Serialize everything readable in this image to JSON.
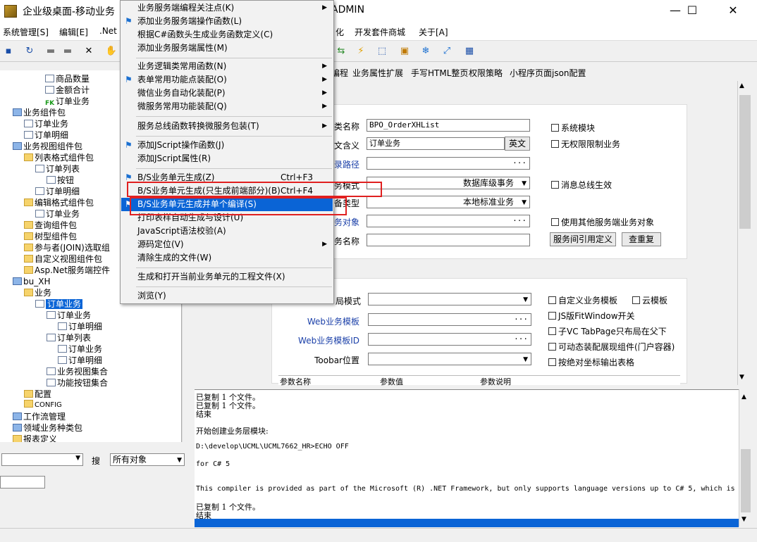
{
  "window": {
    "title": "企业级桌面-移动业务",
    "title_tail": "ADMIN",
    "controls": {
      "minimize": "—",
      "maximize": "☐",
      "close": "✕"
    }
  },
  "menubar": {
    "items": [
      "系统管理[S]",
      "编辑[E]",
      ".Net",
      "化",
      "开发套件商城",
      "关于[A]"
    ]
  },
  "tree": {
    "nodes": [
      {
        "label": "商品数量",
        "icon": "doc"
      },
      {
        "label": "金额合计",
        "icon": "doc"
      },
      {
        "label": "订单业务",
        "icon": "fk",
        "icon_text": "FK"
      },
      {
        "label": "业务组件包",
        "icon": "pkg"
      },
      {
        "label": "订单业务",
        "icon": "doc"
      },
      {
        "label": "订单明细",
        "icon": "doc"
      },
      {
        "label": "业务视图组件包",
        "icon": "pkg"
      },
      {
        "label": "列表格式组件包",
        "icon": "folder"
      },
      {
        "label": "订单列表",
        "icon": "doc"
      },
      {
        "label": "按钮",
        "icon": "doc"
      },
      {
        "label": "订单明细",
        "icon": "doc"
      },
      {
        "label": "编辑格式组件包",
        "icon": "folder"
      },
      {
        "label": "订单业务",
        "icon": "doc"
      },
      {
        "label": "查询组件包",
        "icon": "folder"
      },
      {
        "label": "树型组件包",
        "icon": "folder"
      },
      {
        "label": "参与者(JOIN)选取组",
        "icon": "folder"
      },
      {
        "label": "自定义视图组件包",
        "icon": "folder"
      },
      {
        "label": "Asp.Net服务端控件",
        "icon": "folder"
      },
      {
        "label": "bu_XH",
        "icon": "pkg"
      },
      {
        "label": "业务",
        "icon": "folder"
      },
      {
        "label": "订单业务",
        "icon": "doc",
        "selected": true
      },
      {
        "label": "订单业务",
        "icon": "doc"
      },
      {
        "label": "订单明细",
        "icon": "doc"
      },
      {
        "label": "订单列表",
        "icon": "doc"
      },
      {
        "label": "订单业务",
        "icon": "doc"
      },
      {
        "label": "订单明细",
        "icon": "doc"
      },
      {
        "label": "业务视图集合",
        "icon": "doc"
      },
      {
        "label": "功能按钮集合",
        "icon": "doc"
      },
      {
        "label": "配置",
        "icon": "folder"
      },
      {
        "label": "CONFIG",
        "icon": "folder"
      },
      {
        "label": "工作流管理",
        "icon": "pkg"
      },
      {
        "label": "领域业务种类包",
        "icon": "pkg"
      },
      {
        "label": "报表定义",
        "icon": "folder"
      }
    ]
  },
  "search": {
    "label": "搜",
    "object_type": "所有对象"
  },
  "tabs": [
    "编程",
    "业务属性扩展",
    "手写HTML整页",
    "权限策略",
    "小程序页面json配置"
  ],
  "form": {
    "class_name_label": "类名称",
    "class_name_value": "BPO_OrderXHList",
    "chinese_label": "文含义",
    "chinese_value": "订单业务",
    "english_button": "英文",
    "dir_label": "录路径",
    "mode_label": "务模式",
    "mode_value": "数据库级事务",
    "type_label": "备类型",
    "type_value": "本地标准业务",
    "service_obj_label": "务对象",
    "service_name_label": "务名称",
    "cb_system_module": "系统模块",
    "cb_no_permission": "无权限限制业务",
    "cb_message_bus": "消息总线生效",
    "cb_use_other": "使用其他服务端业务对象",
    "btn_service_ref": "服务间引用定义",
    "btn_check_dup": "查重复",
    "layout_label": "局模式",
    "web_template_label": "Web业务模板",
    "web_template_id_label": "Web业务模板ID",
    "toolbar_pos_label": "Toobar位置",
    "cb_custom_template": "自定义业务模板",
    "cb_cloud_template": "云模板",
    "cb_js_fitwindow": "JS版FitWindow开关",
    "cb_tabpage": "子VC TabPage只布局在父下",
    "cb_dynamic": "可动态装配展现组件(门户容器)",
    "cb_absolute": "按绝对坐标输出表格",
    "param_cols": [
      "参数名称",
      "参数值",
      "参数说明"
    ]
  },
  "output": {
    "lines": [
      "已复制         1 个文件。",
      "已复制         1 个文件。",
      "结束",
      "开始创建业务层模块:",
      "D:\\develop\\UCML\\UCML7662_HR>ECHO OFF",
      "for C# 5",
      "This compiler is provided as part of the Microsoft (R) .NET Framework, but only supports language versions up to C# 5, which is n",
      "已复制         1 个文件。",
      "结束"
    ]
  },
  "context_menu": {
    "items": [
      {
        "label": "业务服务端编程关注点(K)",
        "submenu": true,
        "flag": false
      },
      {
        "label": "添加业务服务端操作函数(L)",
        "submenu": false,
        "flag": true
      },
      {
        "label": "根据C#函数头生成业务函数定义(C)",
        "submenu": false,
        "flag": false
      },
      {
        "label": "添加业务服务端属性(M)",
        "submenu": false,
        "flag": false
      },
      {
        "label": "业务逻辑类常用函数(N)",
        "submenu": true,
        "flag": false
      },
      {
        "label": "表单常用功能点装配(O)",
        "submenu": true,
        "flag": true
      },
      {
        "label": "微信业务自动化装配(P)",
        "submenu": true,
        "flag": false
      },
      {
        "label": "微服务常用功能装配(Q)",
        "submenu": true,
        "flag": false
      },
      {
        "label": "服务总线函数转换微服务包装(T)",
        "submenu": true,
        "flag": false
      },
      {
        "label": "添加JScript操作函数(J)",
        "submenu": false,
        "flag": true
      },
      {
        "label": "添加JScript属性(R)",
        "submenu": false,
        "flag": false
      },
      {
        "label": "B/S业务单元生成(Z)",
        "shortcut": "Ctrl+F3",
        "submenu": false,
        "flag": true
      },
      {
        "label": "B/S业务单元生成(只生成前端部分)(B)",
        "shortcut": "Ctrl+F4",
        "submenu": false,
        "flag": false
      },
      {
        "label": "B/S业务单元生成并单个编译(S)",
        "submenu": false,
        "flag": true,
        "highlighted": true
      },
      {
        "label": "打印表样自动生成与设计(U)",
        "submenu": false,
        "flag": false
      },
      {
        "label": "JavaScript语法校验(A)",
        "submenu": false,
        "flag": false
      },
      {
        "label": "源码定位(V)",
        "submenu": true,
        "flag": false
      },
      {
        "label": "清除生成的文件(W)",
        "submenu": false,
        "flag": false
      },
      {
        "label": "生成和打开当前业务单元的工程文件(X)",
        "submenu": false,
        "flag": false
      },
      {
        "label": "浏览(Y)",
        "submenu": false,
        "flag": false
      }
    ]
  },
  "colors": {
    "selection": "#0a64d6",
    "annotation_box": "#e02020",
    "flag_icon": "#1a6fd0"
  }
}
